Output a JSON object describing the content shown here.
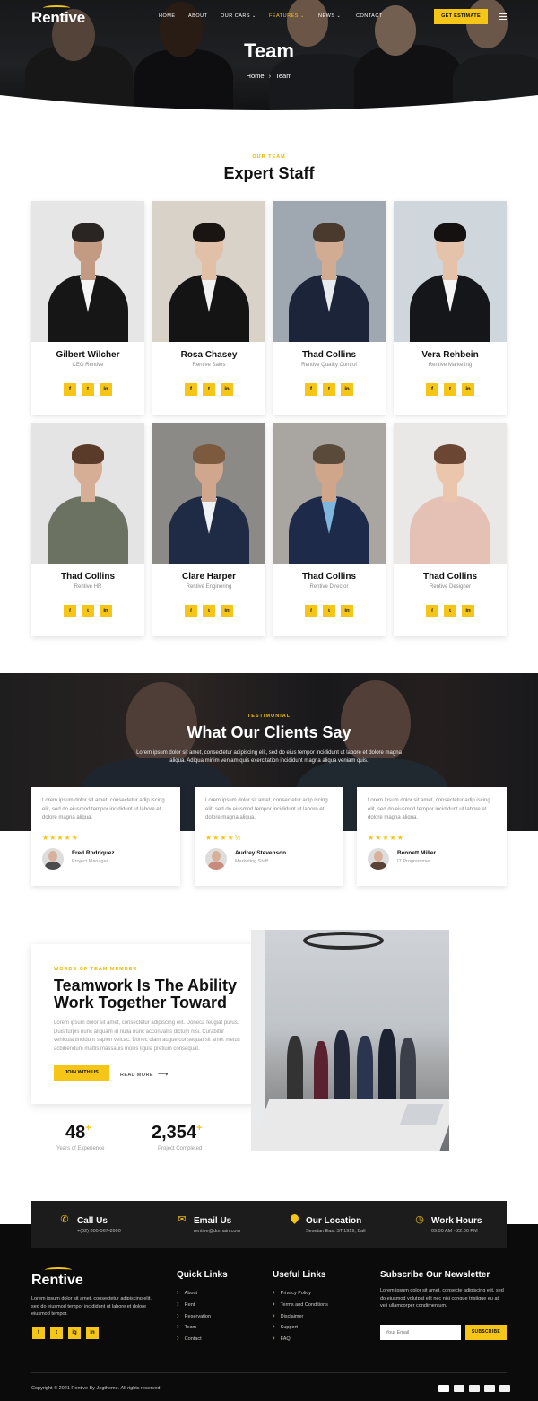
{
  "header": {
    "logo": "Rentive",
    "nav": [
      {
        "label": "HOME",
        "active": false,
        "dropdown": false
      },
      {
        "label": "ABOUT",
        "active": false,
        "dropdown": false
      },
      {
        "label": "OUR CARS",
        "active": false,
        "dropdown": true
      },
      {
        "label": "FEATURES",
        "active": true,
        "dropdown": true
      },
      {
        "label": "NEWS",
        "active": false,
        "dropdown": true
      },
      {
        "label": "CONTACT",
        "active": false,
        "dropdown": false
      }
    ],
    "cta": "GET ESTIMATE"
  },
  "hero": {
    "title": "Team",
    "breadcrumb": [
      "Home",
      "Team"
    ]
  },
  "team": {
    "kicker": "OUR TEAM",
    "title": "Expert Staff",
    "members": [
      {
        "name": "Gilbert Wilcher",
        "role": "CEO Rentive"
      },
      {
        "name": "Rosa Chasey",
        "role": "Rentive Sales"
      },
      {
        "name": "Thad Collins",
        "role": "Rentive Quality Control"
      },
      {
        "name": "Vera Rehbein",
        "role": "Rentive Marketing"
      },
      {
        "name": "Thad Collins",
        "role": "Rentive HR"
      },
      {
        "name": "Clare Harper",
        "role": "Rentive Enginering"
      },
      {
        "name": "Thad Collins",
        "role": "Rentive Director"
      },
      {
        "name": "Thad Collins",
        "role": "Rentive Designer"
      }
    ],
    "social_icons": [
      "facebook-icon",
      "twitter-icon",
      "linkedin-icon"
    ],
    "social_glyphs": [
      "f",
      "t",
      "in"
    ]
  },
  "testimonial": {
    "kicker": "TESTIMONIAL",
    "title": "What Our Clients Say",
    "subtitle": "Lorem ipsum dolor sit amet, consectetur adipiscing elit, sed do eius tempor incididunt ut labore et dolore magna aliqua. Adiqua minim veniam quis exercitation incididunt magna aliqua veniam quis.",
    "reviews": [
      {
        "quote": "Lorem ipsum dolor sit amet, consectetur adip iscing elit, sed do eiusmod tempor incididunt ut labore et dolore magna aliqua.",
        "stars": "★★★★★",
        "rating": 5,
        "name": "Fred Rodriquez",
        "title": "Project Manager"
      },
      {
        "quote": "Lorem ipsum dolor sit amet, consectetur adip iscing elit, sed do eiusmod tempor incididunt ut labore et dolore magna aliqua.",
        "stars": "★★★★½",
        "rating": 4.5,
        "name": "Audrey Stevenson",
        "title": "Marketing Staff"
      },
      {
        "quote": "Lorem ipsum dolor sit amet, consectetur adip iscing elit, sed do eiusmod tempor incididunt ut labore et dolore magna aliqua.",
        "stars": "★★★★★",
        "rating": 5,
        "name": "Bennett Miller",
        "title": "IT Programmer"
      }
    ]
  },
  "about": {
    "kicker": "WORDS OF TEAM MEMBER",
    "title_line1": "Teamwork Is The Ability",
    "title_line2": "Work Together Toward",
    "body": "Lorem ipsum dolor sit amet, consectetur adipiscing elit. Doneca feugiat purus. Duis turpis nunc aliquam id nulla nunc acconvallis dictum nisi. Curabitur vehicula tincidunt sapien velcac. Donec diam augue consequat sit amet metus acbibendum mattis massauis mollis ligula pretium consequat.",
    "primary_button": "JOIN WITH US",
    "secondary_link": "READ MORE",
    "stats": [
      {
        "value": "48",
        "label": "Years of Experience"
      },
      {
        "value": "2,354",
        "label": "Project Completed"
      }
    ]
  },
  "contact": [
    {
      "icon": "phone-icon",
      "title": "Call Us",
      "value": "+(62) 800-567-8990"
    },
    {
      "icon": "envelope-icon",
      "title": "Email Us",
      "value": "rentive@domain.com"
    },
    {
      "icon": "map-pin-icon",
      "title": "Our Location",
      "value": "Sesetan East ST.1919, Bali"
    },
    {
      "icon": "clock-icon",
      "title": "Work Hours",
      "value": "09:00 AM - 22:00 PM"
    }
  ],
  "footer": {
    "logo": "Rentive",
    "about": "Lorem ipsum dolor sit amet, consectetur adipiscing elit, sed do eiusmod tempor incididunt ut labore et dolore eiusmod tempor.",
    "socials": [
      "f",
      "t",
      "ig",
      "in"
    ],
    "quick_links_title": "Quick Links",
    "quick_links": [
      "About",
      "Rent",
      "Reservation",
      "Team",
      "Contact"
    ],
    "useful_links_title": "Useful Links",
    "useful_links": [
      "Privacy Policy",
      "Terms and Conditions",
      "Disclaimer",
      "Support",
      "FAQ"
    ],
    "newsletter_title": "Subscribe Our Newsletter",
    "newsletter_text": "Lorem ipsum dolor sit amet, consecte adipiscing elit, sed do eiusmod volutpat elit nec nisi congue tristique eu at veli ullamcorper condimentum.",
    "email_placeholder": "Your Email",
    "subscribe": "SUBSCRIBE",
    "copyright": "Copyright © 2021 Rentive By Jegtheme. All rights reserved.",
    "payment_icons": [
      "mastercard-icon",
      "amex-icon",
      "visa-icon",
      "card-icon",
      "card-icon"
    ]
  }
}
